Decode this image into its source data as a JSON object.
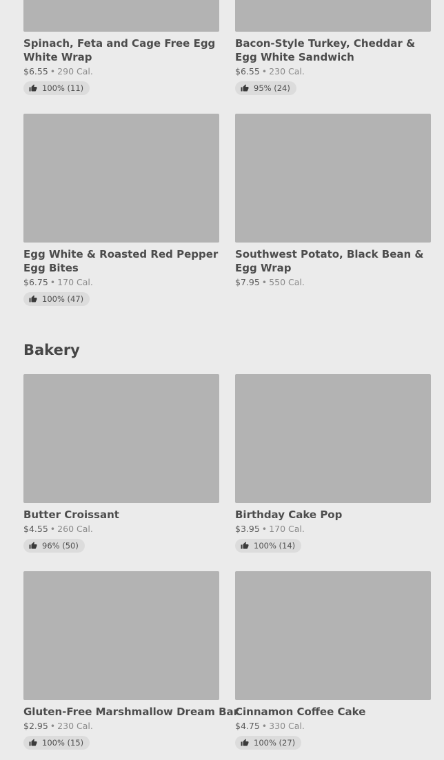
{
  "rows_top": [
    {
      "name": "Spinach, Feta and Cage Free Egg White Wrap",
      "price": "$6.55",
      "calories": "290 Cal.",
      "rating": "100% (11)"
    },
    {
      "name": "Bacon-Style Turkey, Cheddar & Egg White Sandwich",
      "price": "$6.55",
      "calories": "230 Cal.",
      "rating": "95% (24)"
    }
  ],
  "rows_mid": [
    {
      "name": "Egg White & Roasted Red Pepper Egg Bites",
      "price": "$6.75",
      "calories": "170 Cal.",
      "rating": "100% (47)"
    },
    {
      "name": "Southwest Potato, Black Bean & Egg Wrap",
      "price": "$7.95",
      "calories": "550 Cal.",
      "rating": ""
    }
  ],
  "bakery": {
    "title": "Bakery",
    "items": [
      {
        "name": "Butter Croissant",
        "price": "$4.55",
        "calories": "260 Cal.",
        "rating": "96% (50)"
      },
      {
        "name": "Birthday Cake Pop",
        "price": "$3.95",
        "calories": "170 Cal.",
        "rating": "100% (14)"
      },
      {
        "name": "Gluten-Free Marshmallow Dream Bar",
        "price": "$2.95",
        "calories": "230 Cal.",
        "rating": "100% (15)"
      },
      {
        "name": "Cinnamon Coffee Cake",
        "price": "$4.75",
        "calories": "330 Cal.",
        "rating": "100% (27)"
      }
    ]
  },
  "separator": "•",
  "icons": {
    "rating": "thumbs-up-icon"
  }
}
